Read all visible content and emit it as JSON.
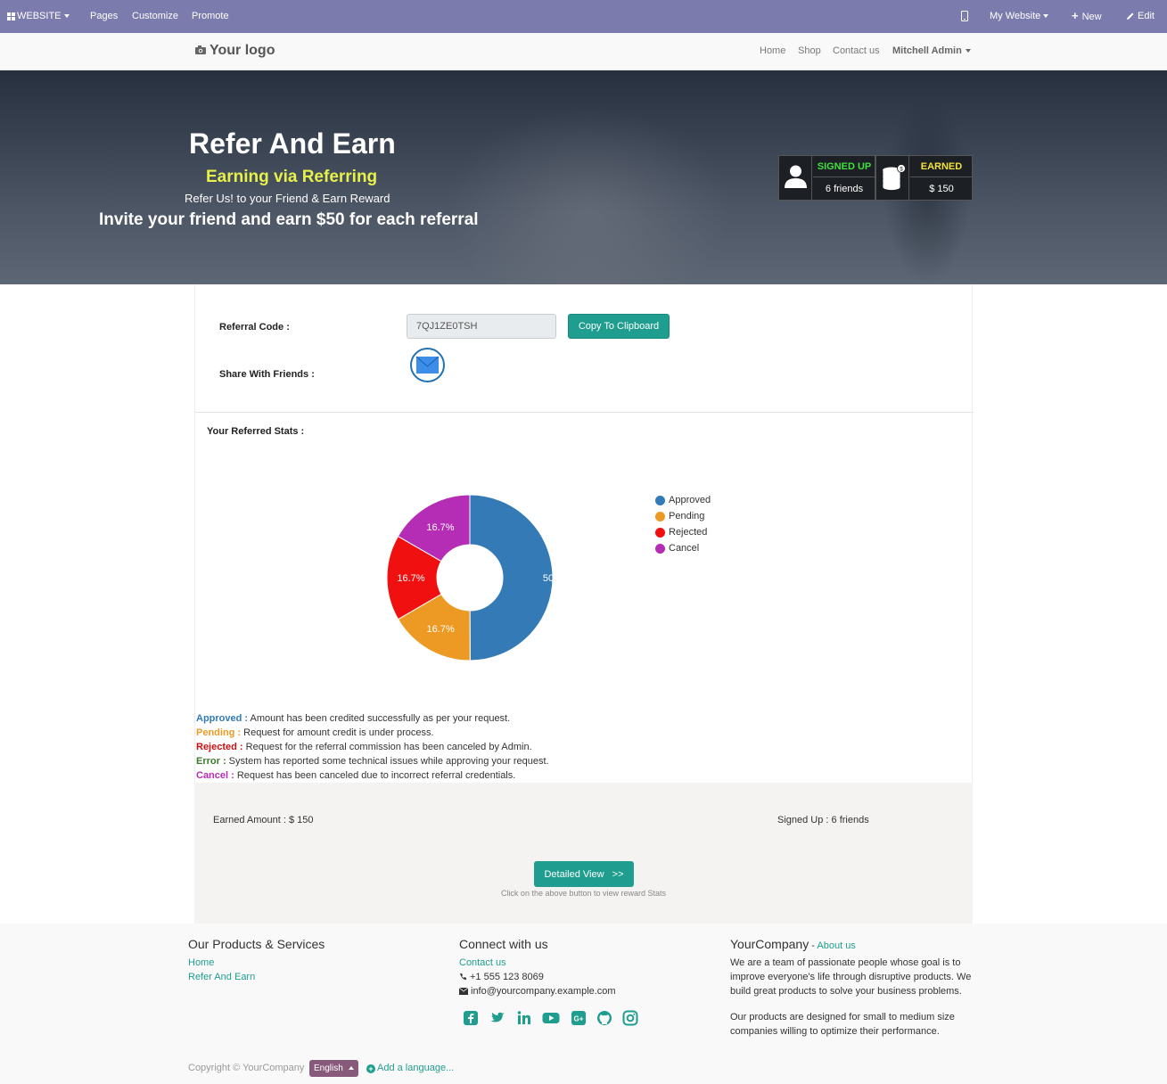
{
  "adminbar": {
    "website_label": "WEBSITE",
    "pages": "Pages",
    "customize": "Customize",
    "promote": "Promote",
    "my_website": "My Website",
    "new": "New",
    "edit": "Edit",
    "bg_color": "#7c7bad"
  },
  "header": {
    "logo_text": "Your logo",
    "nav": [
      "Home",
      "Shop",
      "Contact us"
    ],
    "user": "Mitchell Admin"
  },
  "hero": {
    "title": "Refer And Earn",
    "subtitle": "Earning via Referring",
    "tagline": "Refer Us! to your Friend & Earn Reward",
    "invite": "Invite your friend and earn $50 for each referral",
    "signed_up_label": "SIGNED UP",
    "signed_up_value": "6 friends",
    "earned_label": "EARNED",
    "earned_value": "$ 150"
  },
  "referral": {
    "code_label": "Referral Code :",
    "code_value": "7QJ1ZE0TSH",
    "copy_button": "Copy To Clipboard",
    "share_label": "Share With Friends :"
  },
  "stats": {
    "title": "Your Referred Stats :"
  },
  "chart_data": {
    "type": "pie",
    "categories": [
      "Approved",
      "Pending",
      "Rejected",
      "Cancel"
    ],
    "values": [
      50,
      16.7,
      16.7,
      16.7
    ],
    "labels": [
      "50",
      "16.7%",
      "16.7%",
      "16.7%"
    ],
    "colors": [
      "#337ab7",
      "#ec9a24",
      "#f01010",
      "#b52cb5"
    ],
    "legend": "right"
  },
  "descriptions": [
    {
      "key": "Approved :",
      "text": " Amount has been credited successfully as per your request.",
      "color": "#337ab7"
    },
    {
      "key": "Pending :",
      "text": " Request for amount credit is under process.",
      "color": "#ec9a24"
    },
    {
      "key": "Rejected :",
      "text": " Request for the referral commission has been canceled by Admin.",
      "color": "#cc1111"
    },
    {
      "key": "Error :",
      "text": " System has reported some technical issues while approving your request.",
      "color": "#3c7a2a"
    },
    {
      "key": "Cancel :",
      "text": " Request has been canceled due to incorrect referral credentials.",
      "color": "#b52cb5"
    }
  ],
  "summary": {
    "earned_amount": "Earned Amount : $ 150",
    "signed_up": "Signed Up : 6 friends",
    "detail_button": "Detailed View   >>",
    "detail_hint": "Click on the above button to view reward Stats"
  },
  "footer": {
    "products_title": "Our Products & Services",
    "products_links": [
      "Home",
      "Refer And Earn"
    ],
    "connect_title": "Connect with us",
    "contact_link": "Contact us",
    "phone": "+1 555 123 8069",
    "email": "info@yourcompany.example.com",
    "company_name": "YourCompany",
    "about_sep": " - ",
    "about_link": "About us",
    "para1": "We are a team of passionate people whose goal is to improve everyone's life through disruptive products. We build great products to solve your business problems.",
    "para2": "Our products are designed for small to medium size companies willing to optimize their performance.",
    "copyright": "Copyright © YourCompany",
    "language": "English",
    "add_language": "Add a language...",
    "social_icons": [
      "facebook-icon",
      "twitter-icon",
      "linkedin-icon",
      "youtube-icon",
      "google-plus-icon",
      "github-icon",
      "instagram-icon"
    ],
    "accent": "#1f9d8e"
  }
}
